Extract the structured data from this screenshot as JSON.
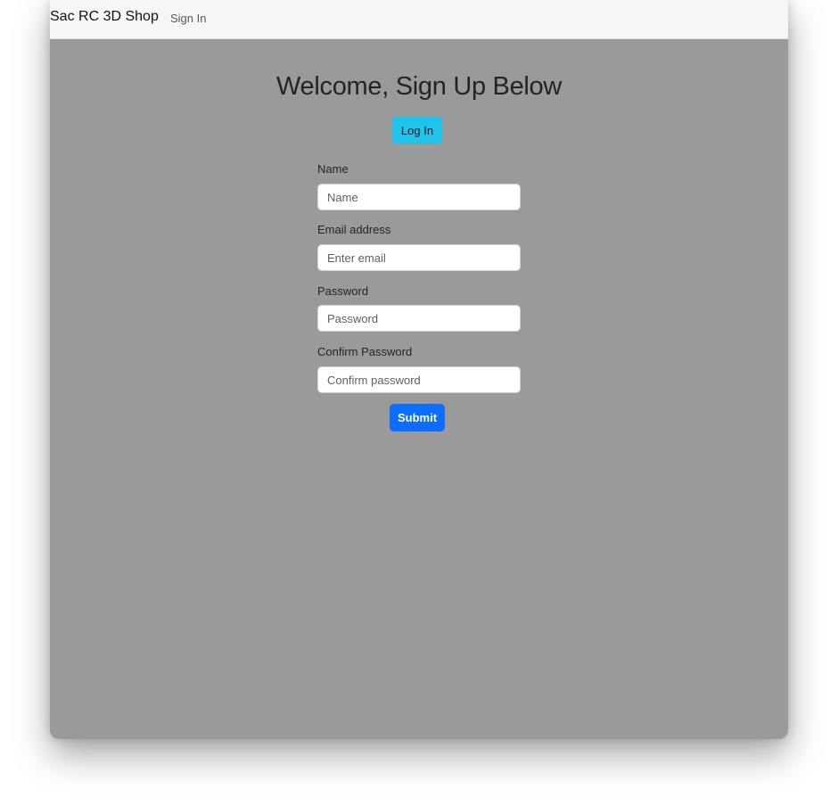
{
  "navbar": {
    "brand": "Sac RC 3D Shop",
    "links": [
      {
        "label": "Sign In"
      }
    ]
  },
  "main": {
    "heading": "Welcome, Sign Up Below",
    "login_button": "Log In",
    "form": {
      "fields": [
        {
          "label": "Name",
          "placeholder": "Name",
          "value": ""
        },
        {
          "label": "Email address",
          "placeholder": "Enter email",
          "value": ""
        },
        {
          "label": "Password",
          "placeholder": "Password",
          "value": ""
        },
        {
          "label": "Confirm Password",
          "placeholder": "Confirm password",
          "value": ""
        }
      ],
      "submit_label": "Submit"
    }
  },
  "colors": {
    "page_background": "#9a9a9a",
    "navbar_background": "#f5f6f8",
    "login_button": "#1cc3ea",
    "submit_button": "#0d6efd"
  }
}
